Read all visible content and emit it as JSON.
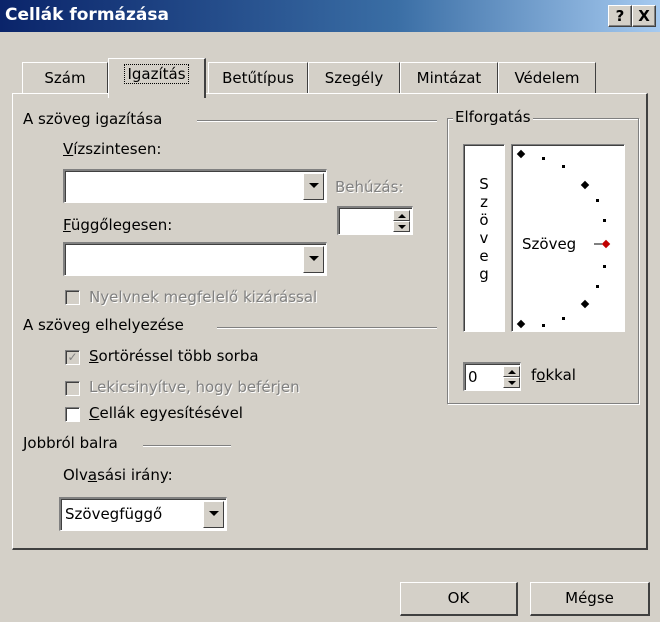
{
  "window": {
    "title": "Cellák formázása",
    "help_label": "?",
    "close_label": "X"
  },
  "tabs": [
    {
      "label": "Szám"
    },
    {
      "label": "Igazítás"
    },
    {
      "label": "Betűtípus"
    },
    {
      "label": "Szegély"
    },
    {
      "label": "Mintázat"
    },
    {
      "label": "Védelem"
    }
  ],
  "text_alignment": {
    "heading": "A szöveg igazítása",
    "horizontal_label": "Vízszintesen:",
    "horizontal_value": "",
    "vertical_label": "Függőlegesen:",
    "vertical_value": "",
    "indent_label": "Behúzás:",
    "indent_value": "",
    "justify_distributed_label": "Nyelvnek megfelelő kizárással"
  },
  "text_control": {
    "heading": "A szöveg elhelyezése",
    "wrap_label": "Sortöréssel több sorba",
    "shrink_label": "Lekicsinyítve, hogy beférjen",
    "merge_label": "Cellák egyesítésével"
  },
  "rtl": {
    "heading": "Jobbról balra",
    "direction_label": "Olvasási irány:",
    "direction_value": "Szövegfüggő"
  },
  "orientation": {
    "heading": "Elforgatás",
    "vertical_text": [
      "S",
      "z",
      "ö",
      "v",
      "e",
      "g"
    ],
    "dial_text": "Szöveg",
    "degrees_value": "0",
    "degrees_label": "fokkal",
    "marker_color": "#c00000"
  },
  "buttons": {
    "ok": "OK",
    "cancel": "Mégse"
  }
}
